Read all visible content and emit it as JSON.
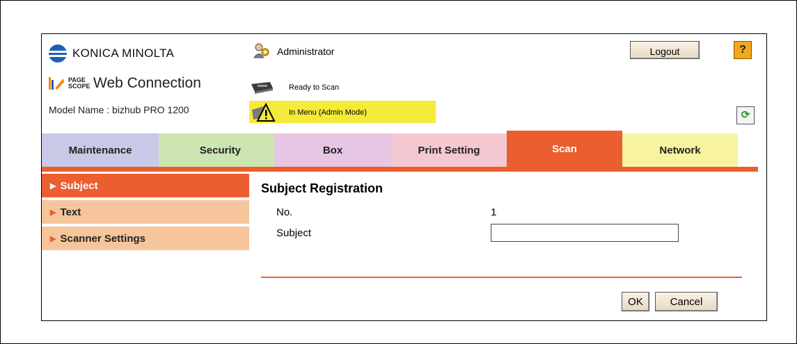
{
  "header": {
    "brand": "KONICA MINOLTA",
    "pagescope_small": "PAGE SCOPE",
    "product": "Web Connection",
    "model_name": "Model Name : bizhub PRO 1200",
    "user": "Administrator",
    "logout_label": "Logout",
    "help_label": "?"
  },
  "status": {
    "ready": "Ready to Scan",
    "warning": "In Menu (Admin Mode)",
    "warning_color": "#f3ea3a"
  },
  "tabs": [
    {
      "label": "Maintenance",
      "color": "#c9c8e6"
    },
    {
      "label": "Security",
      "color": "#cde5b1"
    },
    {
      "label": "Box",
      "color": "#e6c6e2"
    },
    {
      "label": "Print Setting",
      "color": "#f4c8d0"
    },
    {
      "label": "Scan",
      "color": "#ea5e2f",
      "active": true
    },
    {
      "label": "Network",
      "color": "#f7f3a0"
    }
  ],
  "sidebar": {
    "items": [
      {
        "label": "Subject",
        "active": true
      },
      {
        "label": "Text"
      },
      {
        "label": "Scanner Settings"
      }
    ]
  },
  "main": {
    "title": "Subject Registration",
    "no_label": "No.",
    "no_value": "1",
    "subject_label": "Subject",
    "subject_value": ""
  },
  "buttons": {
    "ok": "OK",
    "cancel": "Cancel"
  },
  "icons": {
    "admin": "admin-users-icon",
    "printer": "printer-icon",
    "warning": "warning-icon",
    "refresh": "refresh-icon",
    "arrow": "triangle-right-icon"
  },
  "accent_color": "#ea5e2f"
}
